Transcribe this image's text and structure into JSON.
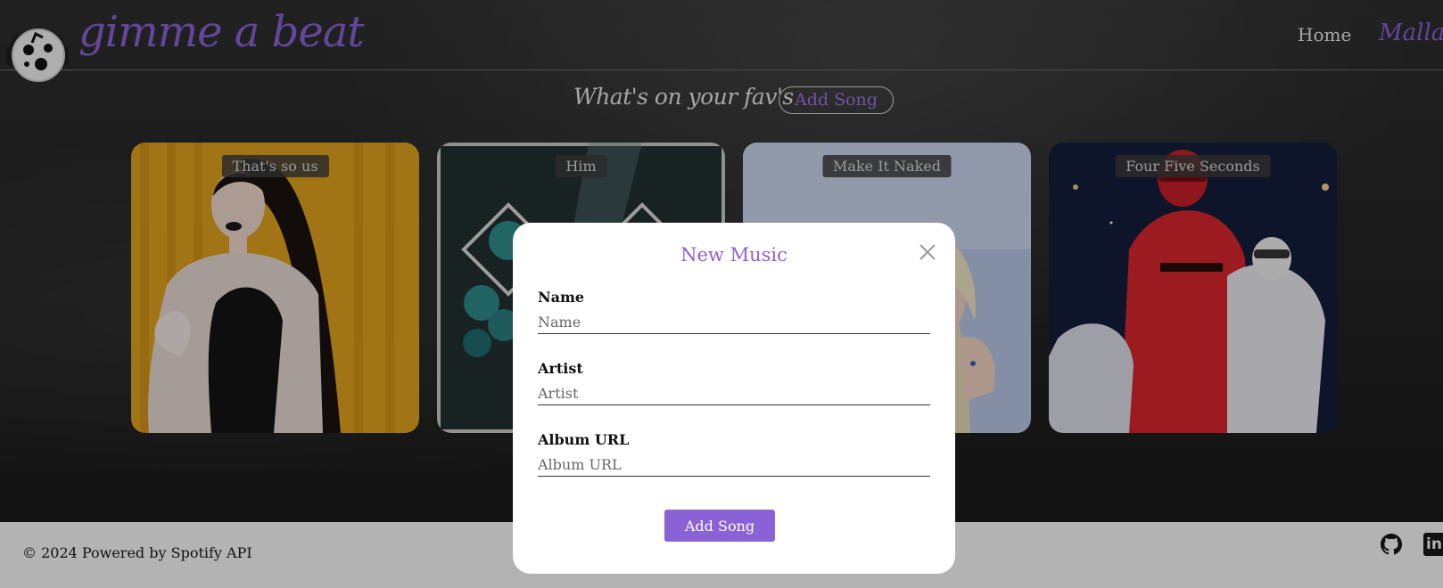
{
  "header": {
    "brand": "gimme a beat",
    "nav_home": "Home",
    "nav_user": "Mallar"
  },
  "main": {
    "tagline": "What's on your fav's",
    "add_song_label": "Add Song",
    "cards": [
      {
        "title": "That's so us"
      },
      {
        "title": "Him"
      },
      {
        "title": "Make It Naked"
      },
      {
        "title": "Four Five Seconds"
      }
    ]
  },
  "modal": {
    "title": "New Music",
    "fields": [
      {
        "label": "Name",
        "placeholder": "Name"
      },
      {
        "label": "Artist",
        "placeholder": "Artist"
      },
      {
        "label": "Album URL",
        "placeholder": "Album URL"
      }
    ],
    "submit_label": "Add Song"
  },
  "footer": {
    "copyright": "© 2024 Powered by Spotify API",
    "linkedin_text": "in"
  },
  "icons": {
    "logo": "music-note-skull-headphones-icon",
    "close": "close-icon",
    "github": "github-icon",
    "linkedin": "linkedin-icon"
  },
  "colors": {
    "accent": "#8a62d6",
    "footer_bg": "#b3b3b3",
    "modal_bg": "#ffffff"
  }
}
